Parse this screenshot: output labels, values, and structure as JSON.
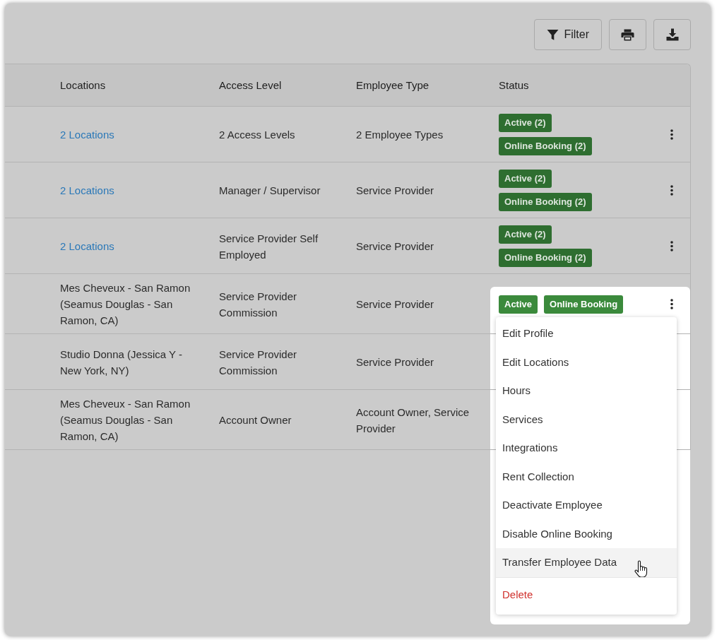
{
  "toolbar": {
    "buttons": [
      {
        "kind": "filter",
        "label": "Filter"
      },
      {
        "kind": "print"
      },
      {
        "kind": "download"
      }
    ]
  },
  "table": {
    "columns": [
      "Locations",
      "Access Level",
      "Employee Type",
      "Status"
    ],
    "rows": [
      {
        "locations": {
          "text": "2 Locations",
          "link": true
        },
        "access_level": "2 Access Levels",
        "employee_type": "2 Employee Types",
        "status": [
          "Active (2)",
          "Online Booking (2)"
        ],
        "menu_open": false
      },
      {
        "locations": {
          "text": "2 Locations",
          "link": true
        },
        "access_level": "Manager / Supervisor",
        "employee_type": "Service Provider",
        "status": [
          "Active (2)",
          "Online Booking (2)"
        ],
        "menu_open": false
      },
      {
        "locations": {
          "text": "2 Locations",
          "link": true
        },
        "access_level": "Service Provider Self Employed",
        "employee_type": "Service Provider",
        "status": [
          "Active (2)",
          "Online Booking (2)"
        ],
        "menu_open": false
      },
      {
        "locations": {
          "text": "Mes Cheveux - San Ramon (Seamus Douglas - San Ramon, CA)",
          "link": false
        },
        "access_level": "Service Provider Commission",
        "employee_type": "Service Provider",
        "status": [
          "Active",
          "Online Booking"
        ],
        "menu_open": true
      },
      {
        "locations": {
          "text": "Studio Donna (Jessica Y - New York, NY)",
          "link": false
        },
        "access_level": "Service Provider Commission",
        "employee_type": "Service Provider",
        "menu_open": false
      },
      {
        "locations": {
          "text": "Mes Cheveux - San Ramon (Seamus Douglas - San Ramon, CA)",
          "link": false
        },
        "access_level": "Account Owner",
        "employee_type": "Account Owner, Service Provider",
        "menu_open": false
      }
    ]
  },
  "row_menu": {
    "items": [
      {
        "label": "Edit Profile",
        "kind": "normal",
        "hovered": false
      },
      {
        "label": "Edit Locations",
        "kind": "normal",
        "hovered": false
      },
      {
        "label": "Hours",
        "kind": "normal",
        "hovered": false
      },
      {
        "label": "Services",
        "kind": "normal",
        "hovered": false
      },
      {
        "label": "Integrations",
        "kind": "normal",
        "hovered": false
      },
      {
        "label": "Rent Collection",
        "kind": "normal",
        "hovered": false
      },
      {
        "label": "Deactivate Employee",
        "kind": "normal",
        "hovered": false
      },
      {
        "label": "Disable Online Booking",
        "kind": "normal",
        "hovered": false
      },
      {
        "label": "Transfer Employee Data",
        "kind": "normal",
        "hovered": true
      },
      {
        "label": "Delete",
        "kind": "danger",
        "hovered": false
      }
    ]
  }
}
